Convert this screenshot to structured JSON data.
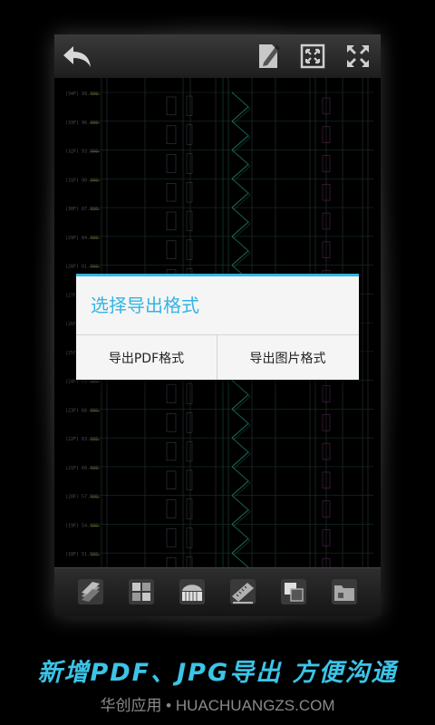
{
  "toolbar": {
    "back_icon": "back-arrow-icon",
    "edit_icon": "edit-document-icon",
    "fit_icon": "fit-screen-icon",
    "fullscreen_icon": "fullscreen-icon"
  },
  "dialog": {
    "title": "选择导出格式",
    "export_pdf_label": "导出PDF格式",
    "export_image_label": "导出图片格式",
    "accent_color": "#33b5e5"
  },
  "bottom_toolbar": {
    "items": [
      "layers-icon",
      "layout-icon",
      "piano-icon",
      "measure-icon",
      "copy-icon",
      "folder-icon"
    ]
  },
  "caption": "新增PDF、JPG导出 方便沟通",
  "footer": "华创应用 • HUACHUANGZS.COM",
  "drawing": {
    "level_labels": [
      "(34F) 99.000",
      "(33F) 96.000",
      "(32F) 93.000",
      "(31F) 90.000",
      "(30F) 87.000",
      "(29F) 84.000",
      "(28F) 81.000",
      "(27F) 78.000",
      "(26F) 75.000",
      "(25F) 72.000",
      "(24F) 69.000",
      "(23F) 66.000",
      "(22F) 63.000",
      "(21F) 60.000",
      "(20F) 57.000",
      "(19F) 54.000",
      "(18F) 51.000"
    ]
  }
}
